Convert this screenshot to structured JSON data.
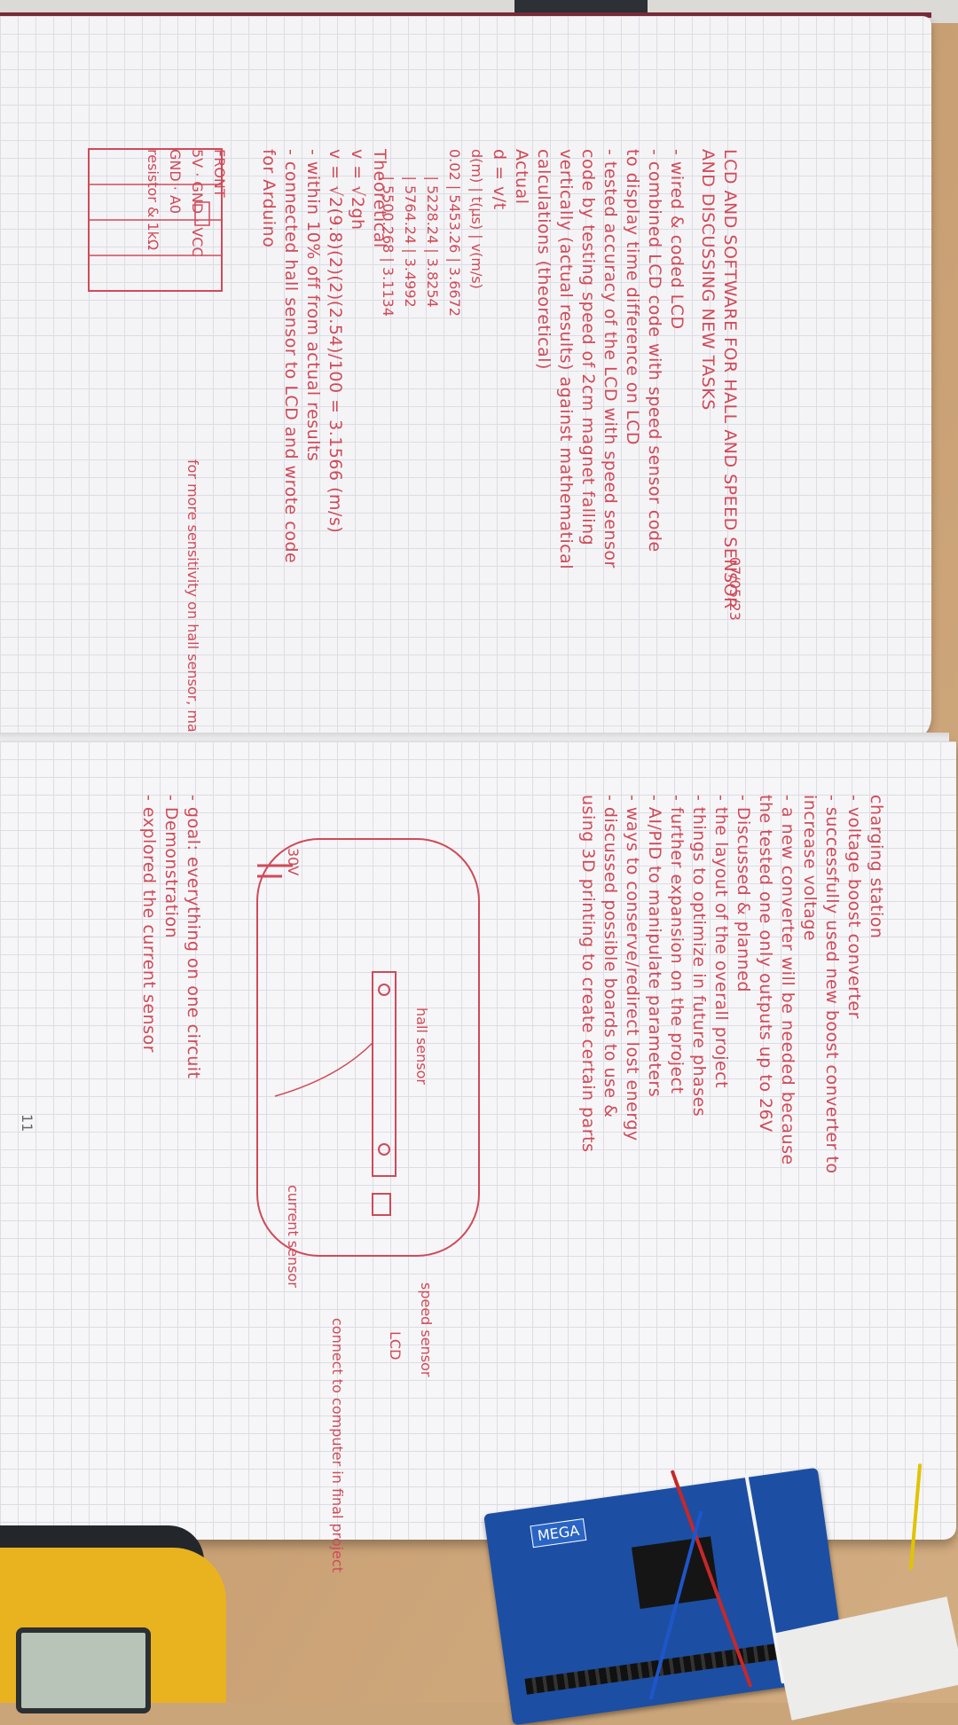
{
  "top_page": {
    "date": "07/05/23",
    "title": "LCD AND SOFTWARE FOR HALL AND SPEED SENSOR",
    "subtitle": "AND DISCUSSING NEW TASKS",
    "lines": [
      "- wired & coded LCD",
      "  - combined LCD code with speed sensor code",
      "    to display time difference on LCD",
      "- tested accuracy of the LCD with speed sensor",
      "  code by testing speed of 2cm magnet falling",
      "  vertically (actual results) against mathematical",
      "  calculations (theoretical)",
      "  Actual",
      "  d = v/t",
      "  Theoretical",
      "  v = √2gh",
      "  v = √2(9.8)(2)(2)(2.54)/100 = 3.1566 (m/s)",
      "  - within 10% off from actual results",
      "- connected hall sensor to LCD and wrote code",
      "  for Arduino"
    ],
    "table": {
      "headers": [
        "d(m)",
        "t(μs)",
        "v(m/s)"
      ],
      "d": "0.02",
      "rows": [
        [
          "5453.26",
          "3.6672"
        ],
        [
          "5228.24",
          "3.8254"
        ],
        [
          "5764.24",
          "3.4992"
        ],
        [
          "5500.268",
          "3.1134"
        ]
      ]
    },
    "diagram": {
      "front": "FRONT",
      "pins": [
        "5V",
        "GND",
        "VCC",
        "GND",
        "A0"
      ],
      "resistor_note": "resistor & 1kΩ",
      "note": "for more sensitivity on hall sensor, make resistance lower"
    }
  },
  "bottom_page": {
    "page_number": "11",
    "lines": [
      "charging station",
      "  - voltage boost converter",
      "    - successfully used new boost converter to",
      "      increase voltage",
      "    - a new converter will be needed because",
      "      the tested one only outputs up to 26V",
      "- Discussed & planned",
      "  - the layout of the overall project",
      "  - things to optimize in future phases",
      "  - further expansion on the project",
      "    - AI/PID to manipulate parameters",
      "    - ways to conserve/redirect lost energy",
      "  - discussed possible boards to use &",
      "    using 3D printing to create certain parts",
      "- goal: everything on one circuit",
      "- Demonstration",
      "  - explored the current sensor"
    ],
    "diagram": {
      "voltage": "30V",
      "hall_sensor": "hall sensor",
      "speed_sensor": "speed sensor",
      "current_sensor": "current sensor",
      "lcd": "LCD",
      "connect_note": "connect to computer in final project"
    }
  },
  "board": {
    "label": "MEGA"
  }
}
